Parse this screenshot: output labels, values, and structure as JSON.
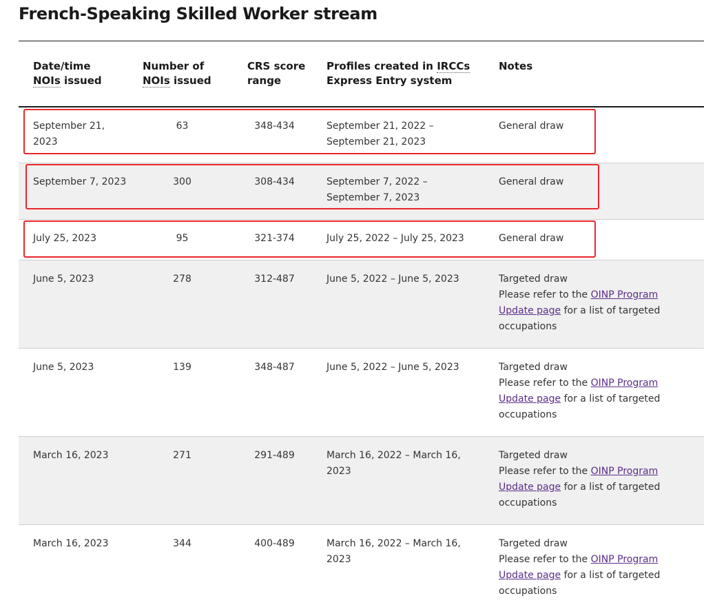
{
  "title": "French-Speaking Skilled Worker stream",
  "table": {
    "headers": {
      "date": {
        "line1": "Date/time",
        "abbr": "NOIs",
        "rest": " issued"
      },
      "num": {
        "line1": "Number of",
        "abbr": "NOIs",
        "rest": " issued"
      },
      "crs": {
        "line1": "CRS score",
        "line2": "range"
      },
      "prof": {
        "line1_pre": "Profiles created in ",
        "abbr": "IRCCs",
        "line2": "Express Entry system"
      },
      "notes": "Notes"
    },
    "rows": [
      {
        "date": "September 21, 2023",
        "num": "63",
        "crs": "348-434",
        "profiles": "September 21, 2022 – September 21, 2023",
        "note_title": "General draw"
      },
      {
        "date": "September 7, 2023",
        "num": "300",
        "crs": "308-434",
        "profiles": "September 7, 2022 – September 7, 2023",
        "note_title": "General draw"
      },
      {
        "date": "July 25, 2023",
        "num": "95",
        "crs": "321-374",
        "profiles": "July 25, 2022 – July 25, 2023",
        "note_title": "General draw"
      },
      {
        "date": "June 5, 2023",
        "num": "278",
        "crs": "312-487",
        "profiles": "June 5, 2022 – June 5, 2023",
        "note_title": "Targeted draw",
        "note_pre": "Please refer to the ",
        "note_link": "OINP Program Update page",
        "note_post": " for a list of targeted occupations"
      },
      {
        "date": "June 5, 2023",
        "num": "139",
        "crs": "348-487",
        "profiles": "June 5, 2022 – June 5, 2023",
        "note_title": "Targeted draw",
        "note_pre": "Please refer to the ",
        "note_link": "OINP Program Update page",
        "note_post": " for a list of targeted occupations"
      },
      {
        "date": "March 16, 2023",
        "num": "271",
        "crs": "291-489",
        "profiles": "March 16, 2022 – March 16, 2023",
        "note_title": "Targeted draw",
        "note_pre": "Please refer to the ",
        "note_link": "OINP Program Update page",
        "note_post": " for a list of targeted occupations"
      },
      {
        "date": "March 16, 2023",
        "num": "344",
        "crs": "400-489",
        "profiles": "March 16, 2022 – March 16, 2023",
        "note_title": "Targeted draw",
        "note_pre": "Please refer to the ",
        "note_link": "OINP Program Update page",
        "note_post": " for a list of targeted occupations"
      }
    ]
  },
  "highlight_color": "#e8262a",
  "link_color": "#5b2c8a"
}
